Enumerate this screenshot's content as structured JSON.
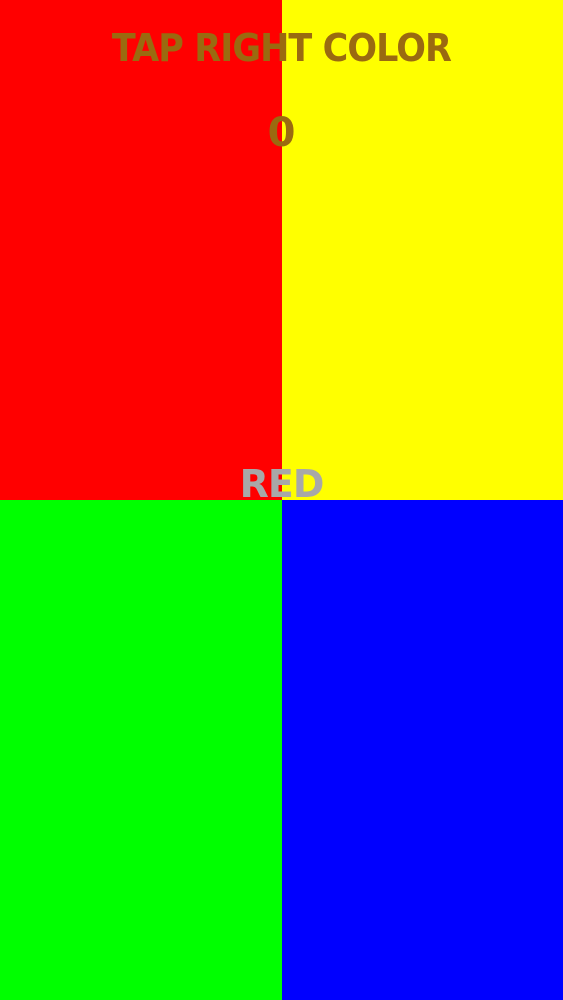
{
  "game": {
    "title": "TAP RIGHT COLOR",
    "score": "0",
    "target_word": "RED",
    "text_color": "#9a6a10",
    "target_word_color": "#a8a8a8"
  },
  "tiles": [
    {
      "name": "red",
      "color": "#ff0000"
    },
    {
      "name": "yellow",
      "color": "#ffff00"
    },
    {
      "name": "green",
      "color": "#00ff00"
    },
    {
      "name": "blue",
      "color": "#0000ff"
    }
  ]
}
